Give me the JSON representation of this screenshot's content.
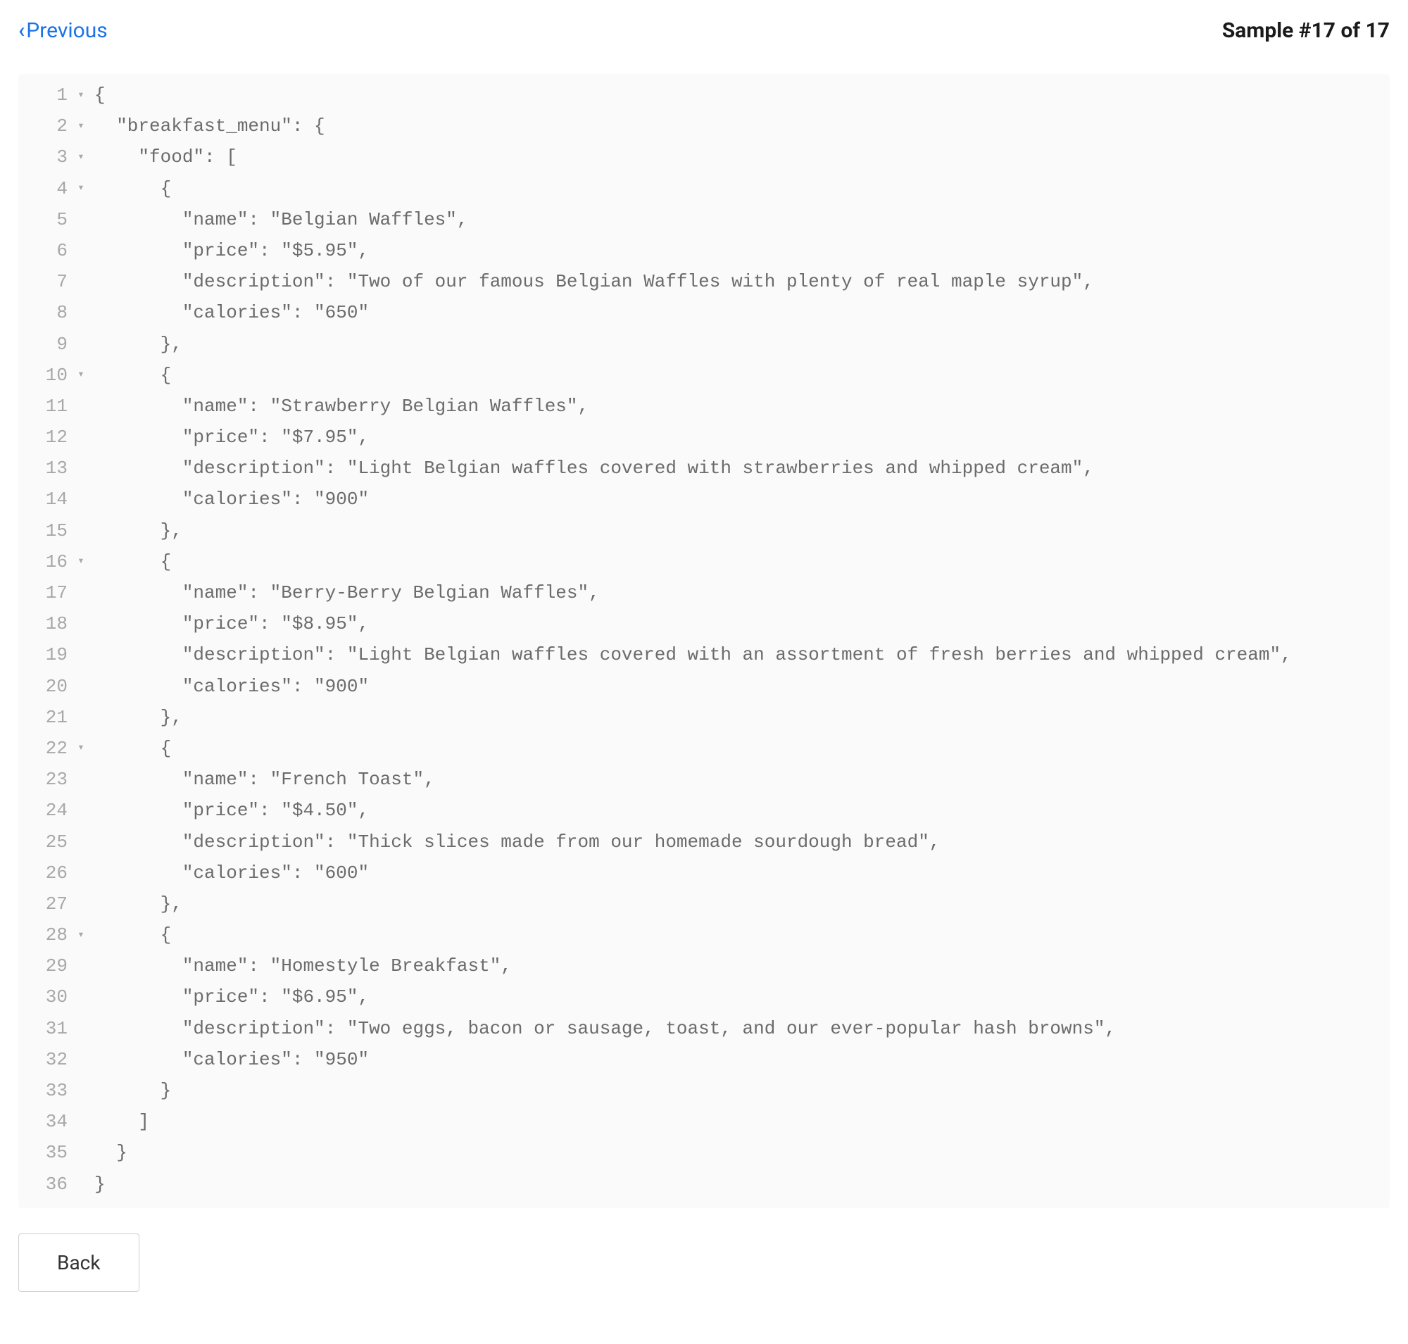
{
  "nav": {
    "previous_label": "Previous",
    "sample_counter": "Sample #17 of 17"
  },
  "code": {
    "lines": [
      {
        "n": 1,
        "fold": true,
        "text": "{"
      },
      {
        "n": 2,
        "fold": true,
        "text": "  \"breakfast_menu\": {"
      },
      {
        "n": 3,
        "fold": true,
        "text": "    \"food\": ["
      },
      {
        "n": 4,
        "fold": true,
        "text": "      {"
      },
      {
        "n": 5,
        "fold": false,
        "text": "        \"name\": \"Belgian Waffles\","
      },
      {
        "n": 6,
        "fold": false,
        "text": "        \"price\": \"$5.95\","
      },
      {
        "n": 7,
        "fold": false,
        "text": "        \"description\": \"Two of our famous Belgian Waffles with plenty of real maple syrup\","
      },
      {
        "n": 8,
        "fold": false,
        "text": "        \"calories\": \"650\""
      },
      {
        "n": 9,
        "fold": false,
        "text": "      },"
      },
      {
        "n": 10,
        "fold": true,
        "text": "      {"
      },
      {
        "n": 11,
        "fold": false,
        "text": "        \"name\": \"Strawberry Belgian Waffles\","
      },
      {
        "n": 12,
        "fold": false,
        "text": "        \"price\": \"$7.95\","
      },
      {
        "n": 13,
        "fold": false,
        "text": "        \"description\": \"Light Belgian waffles covered with strawberries and whipped cream\","
      },
      {
        "n": 14,
        "fold": false,
        "text": "        \"calories\": \"900\""
      },
      {
        "n": 15,
        "fold": false,
        "text": "      },"
      },
      {
        "n": 16,
        "fold": true,
        "text": "      {"
      },
      {
        "n": 17,
        "fold": false,
        "text": "        \"name\": \"Berry-Berry Belgian Waffles\","
      },
      {
        "n": 18,
        "fold": false,
        "text": "        \"price\": \"$8.95\","
      },
      {
        "n": 19,
        "fold": false,
        "text": "        \"description\": \"Light Belgian waffles covered with an assortment of fresh berries and whipped cream\","
      },
      {
        "n": 20,
        "fold": false,
        "text": "        \"calories\": \"900\""
      },
      {
        "n": 21,
        "fold": false,
        "text": "      },"
      },
      {
        "n": 22,
        "fold": true,
        "text": "      {"
      },
      {
        "n": 23,
        "fold": false,
        "text": "        \"name\": \"French Toast\","
      },
      {
        "n": 24,
        "fold": false,
        "text": "        \"price\": \"$4.50\","
      },
      {
        "n": 25,
        "fold": false,
        "text": "        \"description\": \"Thick slices made from our homemade sourdough bread\","
      },
      {
        "n": 26,
        "fold": false,
        "text": "        \"calories\": \"600\""
      },
      {
        "n": 27,
        "fold": false,
        "text": "      },"
      },
      {
        "n": 28,
        "fold": true,
        "text": "      {"
      },
      {
        "n": 29,
        "fold": false,
        "text": "        \"name\": \"Homestyle Breakfast\","
      },
      {
        "n": 30,
        "fold": false,
        "text": "        \"price\": \"$6.95\","
      },
      {
        "n": 31,
        "fold": false,
        "text": "        \"description\": \"Two eggs, bacon or sausage, toast, and our ever-popular hash browns\","
      },
      {
        "n": 32,
        "fold": false,
        "text": "        \"calories\": \"950\""
      },
      {
        "n": 33,
        "fold": false,
        "text": "      }"
      },
      {
        "n": 34,
        "fold": false,
        "text": "    ]"
      },
      {
        "n": 35,
        "fold": false,
        "text": "  }"
      },
      {
        "n": 36,
        "fold": false,
        "text": "}"
      }
    ]
  },
  "back_button_label": "Back"
}
